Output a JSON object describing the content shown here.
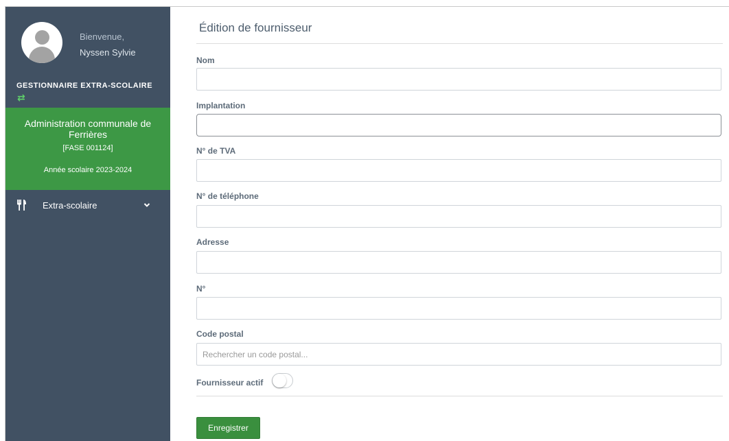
{
  "sidebar": {
    "welcome": "Bienvenue,",
    "user_name": "Nyssen Sylvie",
    "role": "GESTIONNAIRE EXTRA-SCOLAIRE",
    "swap_icon": "⇄",
    "organization": {
      "name": "Administration communale de Ferrières",
      "code": "[FASE 001124]",
      "school_year": "Année scolaire 2023-2024"
    },
    "menu": [
      {
        "label": "Extra-scolaire",
        "icon": "fork-knife-icon"
      }
    ]
  },
  "form": {
    "title": "Édition de fournisseur",
    "fields": {
      "nom": {
        "label": "Nom",
        "value": ""
      },
      "implantation": {
        "label": "Implantation",
        "value": ""
      },
      "tva": {
        "label": "N° de TVA",
        "value": ""
      },
      "telephone": {
        "label": "N° de téléphone",
        "value": ""
      },
      "adresse": {
        "label": "Adresse",
        "value": ""
      },
      "numero": {
        "label": "N°",
        "value": ""
      },
      "code_postal": {
        "label": "Code postal",
        "value": "",
        "placeholder": "Rechercher un code postal..."
      }
    },
    "active": {
      "label": "Fournisseur actif",
      "value": false
    },
    "save_label": "Enregistrer"
  },
  "colors": {
    "sidebar_bg": "#415163",
    "org_bg": "#3d9845",
    "primary_button": "#3a8f3e"
  }
}
